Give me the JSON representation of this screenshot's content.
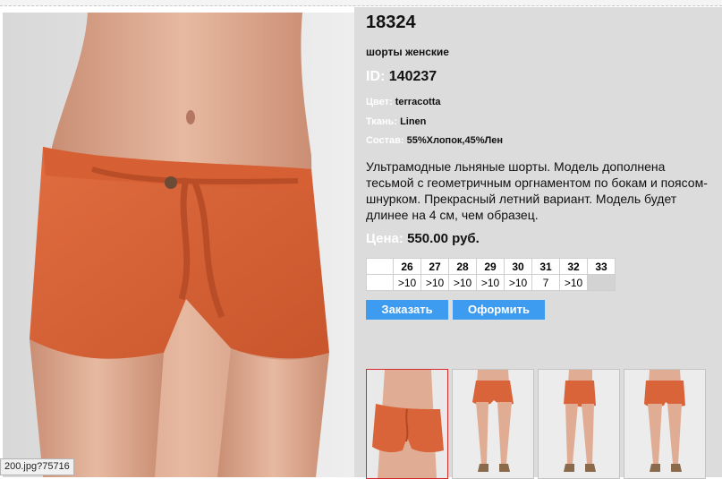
{
  "product": {
    "title": "18324",
    "subtitle": "шорты женские",
    "id_label": "ID:",
    "id_value": "140237",
    "color_label": "Цвет:",
    "color_value": "terracotta",
    "fabric_label": "Ткань:",
    "fabric_value": "Linen",
    "composition_label": "Состав:",
    "composition_value": "55%Хлопок,45%Лен",
    "description": "Ультрамодные льняные шорты. Модель дополнена тесьмой с геометричным оргнаментом по бокам и поясом-шнурком.  Прекрасный летний вариант. Модель будет длинее на 4 см, чем образец.",
    "price_label": "Цена:",
    "price_value": "550.00 руб."
  },
  "sizes": {
    "headers": [
      "",
      "26",
      "27",
      "28",
      "29",
      "30",
      "31",
      "32",
      "33"
    ],
    "stock": [
      "",
      ">10",
      ">10",
      ">10",
      ">10",
      ">10",
      "7",
      ">10",
      ""
    ]
  },
  "buttons": {
    "order": "Заказать",
    "checkout": "Оформить"
  },
  "status_bar": {
    "url": "200.jpg?75716"
  },
  "colors": {
    "shorts": "#d9643a",
    "skin": "#e3b299",
    "button": "#3d9bf0",
    "panel": "#dcdcdc",
    "active_thumb_border": "#d42a2a"
  }
}
